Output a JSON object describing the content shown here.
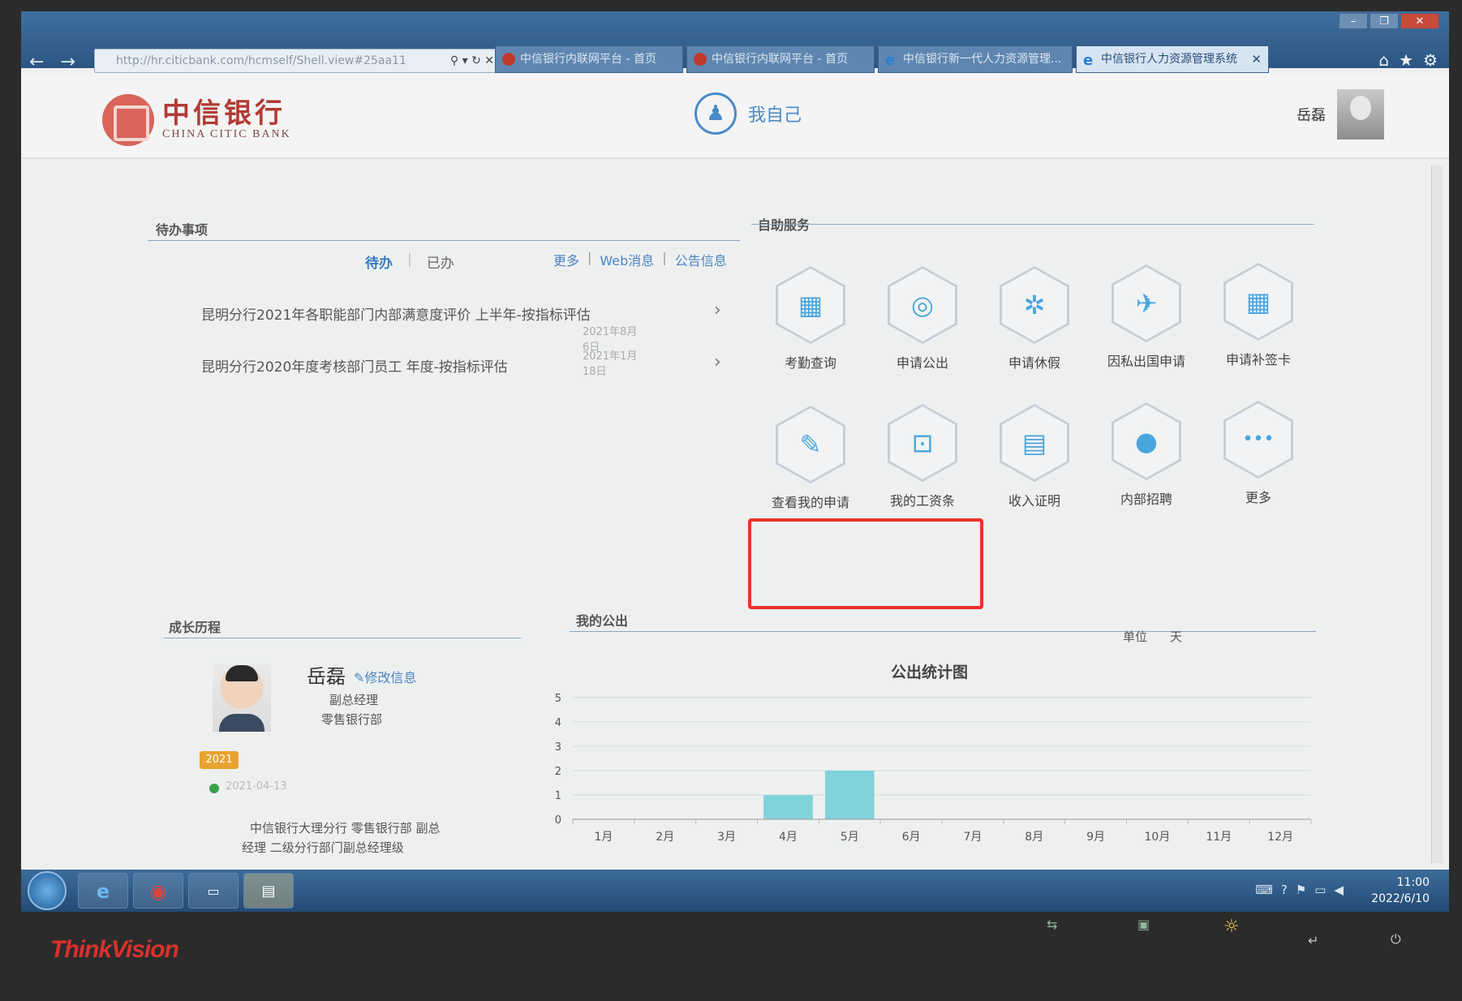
{
  "browser": {
    "address": "http://hr.citicbank.com/hcmself/Shell.view#25aa11",
    "tabs": [
      {
        "label": "中信银行内联网平台 - 首页",
        "active": false
      },
      {
        "label": "中信银行内联网平台 - 首页",
        "active": false
      },
      {
        "label": "中信银行新一代人力资源管理...",
        "active": false
      },
      {
        "label": "中信银行人力资源管理系统",
        "active": true
      }
    ]
  },
  "header": {
    "logo_cn": "中信银行",
    "logo_en": "CHINA CITIC BANK",
    "nav_label": "我自己",
    "user_name": "岳磊"
  },
  "todo": {
    "title": "待办事项",
    "tab_pending": "待办",
    "tab_done": "已办",
    "links": [
      "更多",
      "Web消息",
      "公告信息"
    ],
    "items": [
      {
        "text": "昆明分行2021年各职能部门内部满意度评价 上半年-按指标评估",
        "date": "2021年8月6日"
      },
      {
        "text": "昆明分行2020年度考核部门员工 年度-按指标评估",
        "date": "2021年1月18日"
      }
    ]
  },
  "services": {
    "title": "自助服务",
    "items": [
      {
        "label": "考勤查询",
        "icon": "calendar-icon",
        "glyph": "▦"
      },
      {
        "label": "申请公出",
        "icon": "lifebuoy-icon",
        "glyph": "◎"
      },
      {
        "label": "申请休假",
        "icon": "gear-icon",
        "glyph": "✲"
      },
      {
        "label": "因私出国申请",
        "icon": "airplane-icon",
        "glyph": "✈"
      },
      {
        "label": "申请补签卡",
        "icon": "calendar-check-icon",
        "glyph": "▦"
      },
      {
        "label": "查看我的申请",
        "icon": "edit-icon",
        "glyph": "✎"
      },
      {
        "label": "我的工资条",
        "icon": "money-icon",
        "glyph": "⊡"
      },
      {
        "label": "收入证明",
        "icon": "document-icon",
        "glyph": "▤"
      },
      {
        "label": "内部招聘",
        "icon": "person-icon",
        "glyph": "●"
      },
      {
        "label": "更多",
        "icon": "more-icon",
        "glyph": "•••"
      }
    ]
  },
  "growth": {
    "title": "成长历程",
    "name": "岳磊",
    "edit_label": "修改信息",
    "position": "副总经理",
    "department": "零售银行部",
    "year": "2021",
    "date": "2021-04-13",
    "history_line1": "中信银行大理分行   零售银行部   副总",
    "history_line2": "经理   二级分行部门副总经理级"
  },
  "trips": {
    "title": "我的公出",
    "unit_label": "单位",
    "unit_value": "天"
  },
  "chart_data": {
    "type": "bar",
    "title": "公出统计图",
    "categories": [
      "1月",
      "2月",
      "3月",
      "4月",
      "5月",
      "6月",
      "7月",
      "8月",
      "9月",
      "10月",
      "11月",
      "12月"
    ],
    "values": [
      0,
      0,
      0,
      1,
      2,
      0,
      0,
      0,
      0,
      0,
      0,
      0
    ],
    "yticks": [
      0,
      1,
      2,
      3,
      4,
      5
    ],
    "ylim": [
      0,
      5
    ],
    "grid": true,
    "bar_color": "#7fd3d9"
  },
  "taskbar": {
    "time": "11:00",
    "date": "2022/6/10"
  },
  "monitor": {
    "brand": "ThinkVision"
  },
  "colors": {
    "accent": "#4a85c3",
    "brand_red": "#b23a34",
    "highlight_box": "#e8332a"
  }
}
